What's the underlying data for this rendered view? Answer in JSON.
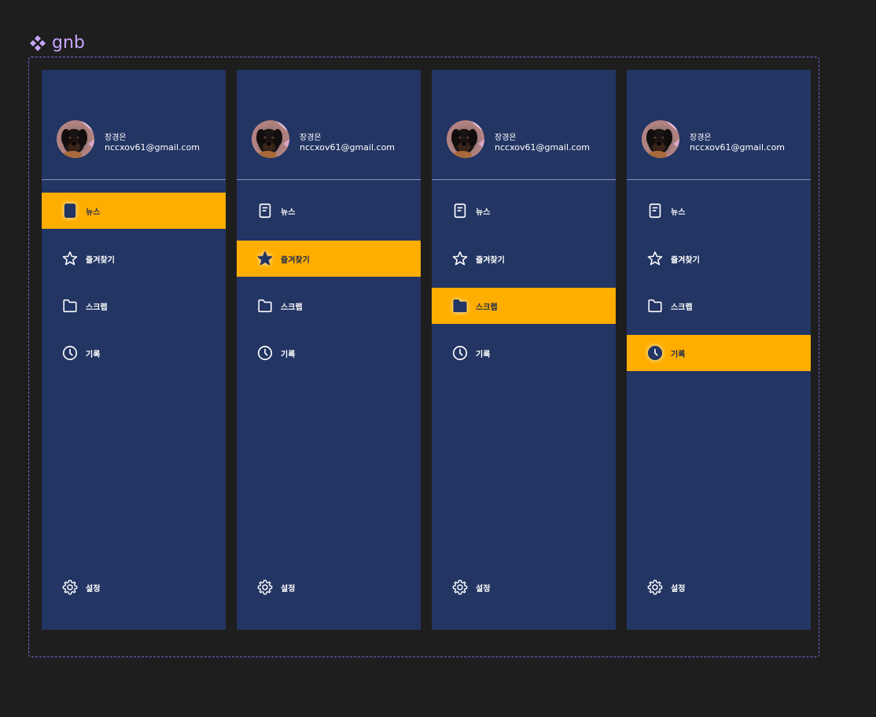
{
  "canvas": {
    "component_set_name": "gnb",
    "colors": {
      "background": "#1e1e1e",
      "panel": "#233563",
      "active": "#ffae00",
      "frame_border": "#8a5cd8",
      "label": "#c8a6ff"
    }
  },
  "variants": [
    {
      "profile": {
        "name": "장경은",
        "email": "nccxov61@gmail.com"
      },
      "active_item": "news",
      "menu": [
        {
          "id": "news",
          "label": "뉴스",
          "icon": "news-icon"
        },
        {
          "id": "favorites",
          "label": "즐겨찾기",
          "icon": "star-icon"
        },
        {
          "id": "scrap",
          "label": "스크랩",
          "icon": "folder-icon"
        },
        {
          "id": "history",
          "label": "기록",
          "icon": "clock-icon"
        }
      ],
      "settings": {
        "label": "설정",
        "icon": "gear-icon"
      }
    },
    {
      "profile": {
        "name": "장경은",
        "email": "nccxov61@gmail.com"
      },
      "active_item": "favorites",
      "menu": [
        {
          "id": "news",
          "label": "뉴스",
          "icon": "news-icon"
        },
        {
          "id": "favorites",
          "label": "즐겨찾기",
          "icon": "star-icon"
        },
        {
          "id": "scrap",
          "label": "스크랩",
          "icon": "folder-icon"
        },
        {
          "id": "history",
          "label": "기록",
          "icon": "clock-icon"
        }
      ],
      "settings": {
        "label": "설정",
        "icon": "gear-icon"
      }
    },
    {
      "profile": {
        "name": "장경은",
        "email": "nccxov61@gmail.com"
      },
      "active_item": "scrap",
      "menu": [
        {
          "id": "news",
          "label": "뉴스",
          "icon": "news-icon"
        },
        {
          "id": "favorites",
          "label": "즐겨찾기",
          "icon": "star-icon"
        },
        {
          "id": "scrap",
          "label": "스크랩",
          "icon": "folder-icon"
        },
        {
          "id": "history",
          "label": "기록",
          "icon": "clock-icon"
        }
      ],
      "settings": {
        "label": "설정",
        "icon": "gear-icon"
      }
    },
    {
      "profile": {
        "name": "장경은",
        "email": "nccxov61@gmail.com"
      },
      "active_item": "history",
      "menu": [
        {
          "id": "news",
          "label": "뉴스",
          "icon": "news-icon"
        },
        {
          "id": "favorites",
          "label": "즐겨찾기",
          "icon": "star-icon"
        },
        {
          "id": "scrap",
          "label": "스크랩",
          "icon": "folder-icon"
        },
        {
          "id": "history",
          "label": "기록",
          "icon": "clock-icon"
        }
      ],
      "settings": {
        "label": "설정",
        "icon": "gear-icon"
      }
    }
  ]
}
